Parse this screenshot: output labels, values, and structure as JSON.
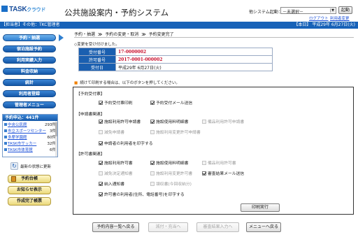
{
  "header": {
    "logo_text": "TASK",
    "logo_suffix": "クラウド",
    "app_title": "公共施設案内・予約システム",
    "switch_label": "他システム起動：",
    "system_select": {
      "selected": "－未選択－"
    },
    "start_button": "起動",
    "logout_link": "ログアウト",
    "change_link": "利用者変更"
  },
  "status_bar": {
    "left": "【担当者】その他：TKC管理者",
    "right": "【本日】 平成29年 6月27日(火)"
  },
  "sidebar": {
    "buttons": [
      "予約・抽選",
      "宿泊施設予約",
      "利用実績入力",
      "料金収納",
      "統計",
      "利用者登録",
      "管理者メニュー"
    ],
    "active_index": 0,
    "list_title": "予約申込：441件",
    "list_items": [
      {
        "name": "中央公民館",
        "count": "293件"
      },
      {
        "name": "市立スポーツセンター",
        "count": "3件"
      },
      {
        "name": "多摩学園館",
        "count": "60件"
      },
      {
        "name": "TASK市サッカー",
        "count": "32件"
      },
      {
        "name": "TASK市体育館",
        "count": "6件"
      }
    ],
    "refresh_label": "最新の状態に更新",
    "extra_buttons": [
      "予約台帳",
      "お知らせ表示",
      "作成完了帳票"
    ]
  },
  "breadcrumb": [
    "予約・抽選",
    "予約の変更・取消",
    "予約変更完了"
  ],
  "accept_msg": "◇変更を受け付けました。",
  "info_table": [
    {
      "label": "受付番号",
      "value": "17-0000002",
      "highlight": true
    },
    {
      "label": "許可番号",
      "value": "2017-0001-000002",
      "highlight": true
    },
    {
      "label": "受付日",
      "value": "平成29年 6月27日(火)",
      "highlight": false
    }
  ],
  "print_note": "続けて印刷する場合は、以下のボタンを押してください。",
  "print_box": {
    "sections": {
      "reservation": "【予約受付票】",
      "application": "【申請書関連】",
      "permit": "【許可書関連】"
    },
    "checkboxes": {
      "r1": {
        "label": "予約受付票印刷",
        "checked": true,
        "disabled": false
      },
      "r2": {
        "label": "予約受付メール送信",
        "checked": true,
        "disabled": false
      },
      "a1": {
        "label": "施設利用許可申請書",
        "checked": true,
        "disabled": false
      },
      "a2": {
        "label": "施設使用料明細書",
        "checked": true,
        "disabled": false
      },
      "a3": {
        "label": "備品利用許可申請書",
        "checked": false,
        "disabled": true
      },
      "a4": {
        "label": "減免申請書",
        "checked": false,
        "disabled": true
      },
      "a5": {
        "label": "施設利用変更許可申請書",
        "checked": false,
        "disabled": true
      },
      "a6": {
        "label": "申請者の利用者を印字する",
        "checked": true,
        "disabled": false
      },
      "p1": {
        "label": "施設利用許可書",
        "checked": true,
        "disabled": false
      },
      "p2": {
        "label": "施設使用料明細書",
        "checked": true,
        "disabled": false
      },
      "p3": {
        "label": "備品利用許可書",
        "checked": false,
        "disabled": true
      },
      "p4": {
        "label": "減免決定通知書",
        "checked": false,
        "disabled": true
      },
      "p5": {
        "label": "施設利用変更許可書",
        "checked": false,
        "disabled": true
      },
      "p6": {
        "label": "審査結果メール送信",
        "checked": true,
        "disabled": false
      },
      "p7": {
        "label": "納入通知書",
        "checked": true,
        "disabled": false
      },
      "p8": {
        "label": "領収書(今回収納分)",
        "checked": false,
        "disabled": true
      },
      "p9": {
        "label": "許可書の利用者(住所、電話番号)を印字する",
        "checked": true,
        "disabled": false
      }
    },
    "print_button": "印刷実行"
  },
  "bottom_buttons": [
    {
      "label": "予約内容一覧へ戻る",
      "disabled": false
    },
    {
      "label": "減付・充当へ",
      "disabled": true
    },
    {
      "label": "審査結果入力へ",
      "disabled": true
    },
    {
      "label": "メニューへ戻る",
      "disabled": false
    }
  ]
}
